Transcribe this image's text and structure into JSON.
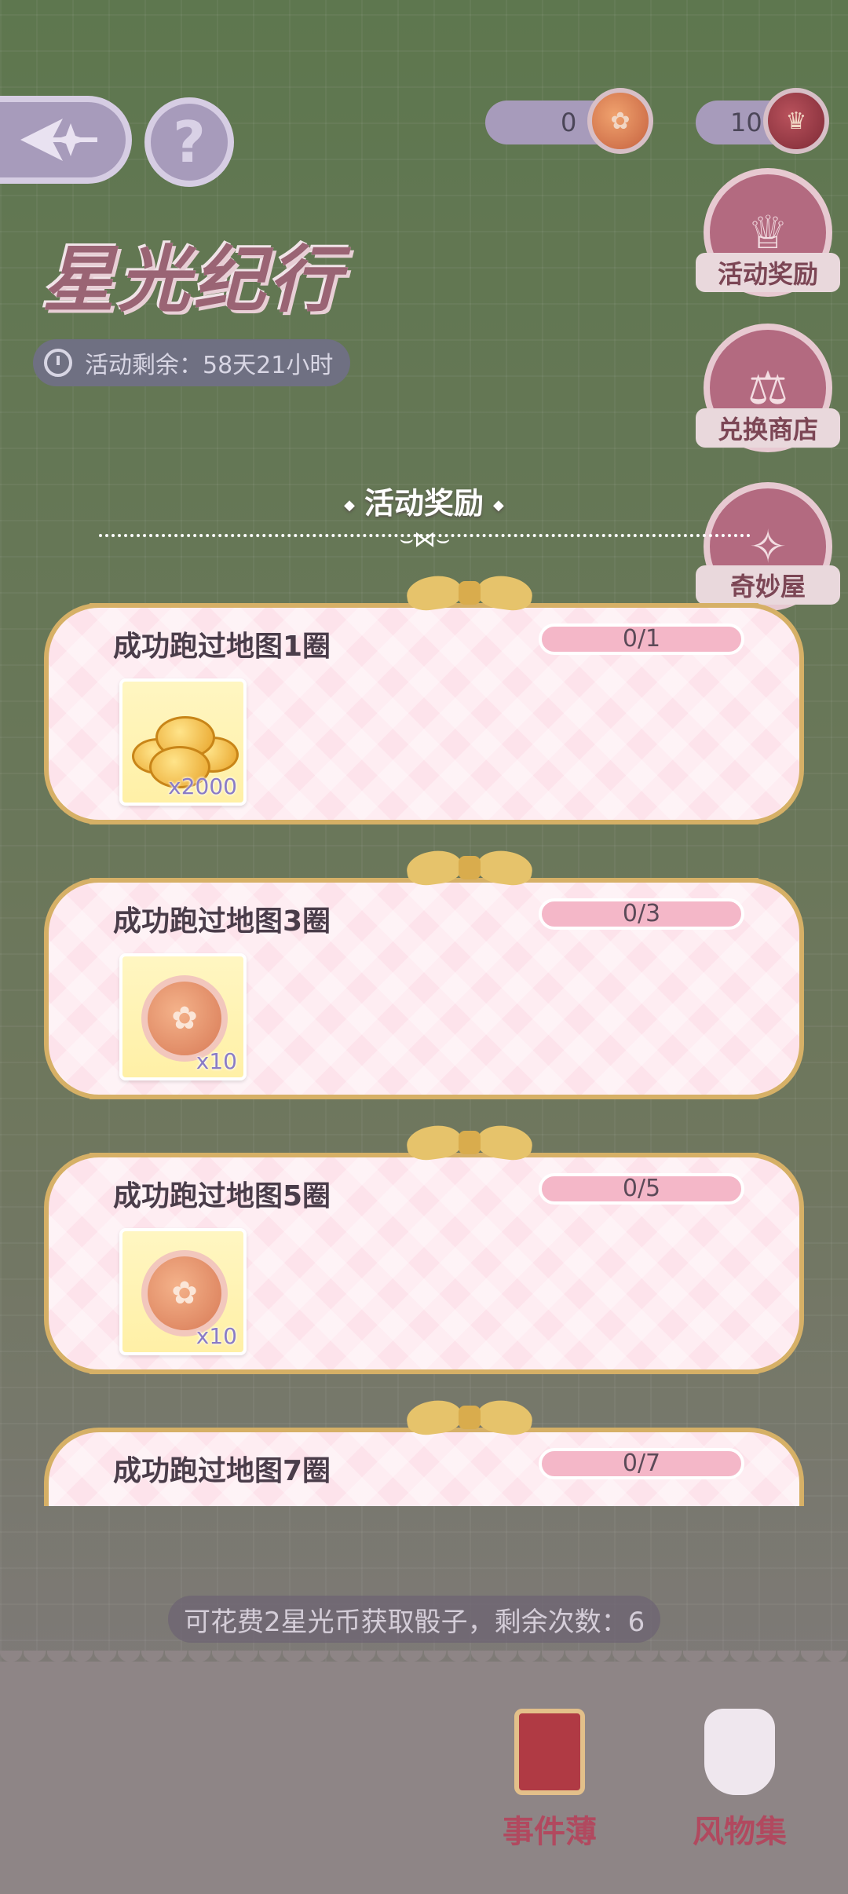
{
  "header": {
    "help_symbol": "?",
    "logo_text": "星光纪行",
    "timer_text": "活动剩余：58天21小时",
    "currency_1": "0",
    "currency_2": "10"
  },
  "side_menu": [
    {
      "label": "活动奖励",
      "icon": "reward-icon"
    },
    {
      "label": "兑换商店",
      "icon": "scale-icon"
    },
    {
      "label": "奇妙屋",
      "icon": "magic-icon"
    }
  ],
  "panel": {
    "title": "活动奖励",
    "rewards": [
      {
        "title": "成功跑过地图1圈",
        "current": 0,
        "total": 1,
        "progress_text": "0/1",
        "item_type": "gold",
        "qty": "x2000"
      },
      {
        "title": "成功跑过地图3圈",
        "current": 0,
        "total": 3,
        "progress_text": "0/3",
        "item_type": "token",
        "qty": "x10"
      },
      {
        "title": "成功跑过地图5圈",
        "current": 0,
        "total": 5,
        "progress_text": "0/5",
        "item_type": "token",
        "qty": "x10"
      },
      {
        "title": "成功跑过地图7圈",
        "current": 0,
        "total": 7,
        "progress_text": "0/7",
        "item_type": "",
        "qty": ""
      }
    ]
  },
  "hint_text": "可花费2星光币获取骰子，剩余次数：6",
  "dock": [
    {
      "label": "事件薄",
      "icon": "book-icon"
    },
    {
      "label": "风物集",
      "icon": "bottle-icon"
    }
  ]
}
